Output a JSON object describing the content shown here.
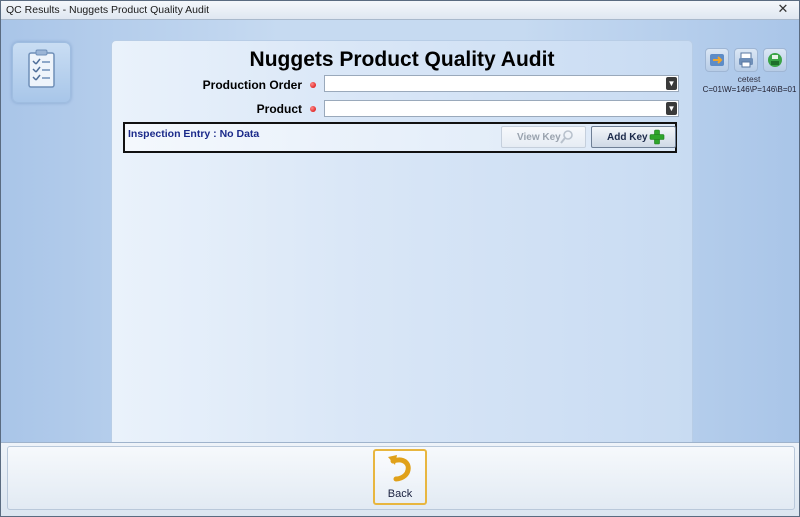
{
  "window": {
    "title": "QC Results - Nuggets Product Quality Audit",
    "close_glyph": "✕"
  },
  "form": {
    "title": "Nuggets Product Quality Audit",
    "production_order_label": "Production Order",
    "product_label": "Product",
    "production_order_value": "",
    "product_value": ""
  },
  "inspection": {
    "status_label": "Inspection Entry : No Data",
    "view_key_label": "View Key",
    "add_key_label": "Add Key"
  },
  "user": {
    "name": "cetest",
    "path": "C=01\\W=146\\P=146\\B=01"
  },
  "footer": {
    "back_label": "Back"
  },
  "icons": {
    "form_icon": "clipboard-checklist-icon",
    "right_1": "transfer-icon",
    "right_2": "print-icon",
    "right_3": "save-icon",
    "view_key": "magnifier-icon",
    "add_key": "plus-icon",
    "back": "back-arrow-icon"
  },
  "colors": {
    "required_dot": "#d40000",
    "inspection_text": "#1b2a8a",
    "back_border": "#e8b640",
    "add_green": "#2fa52b"
  }
}
